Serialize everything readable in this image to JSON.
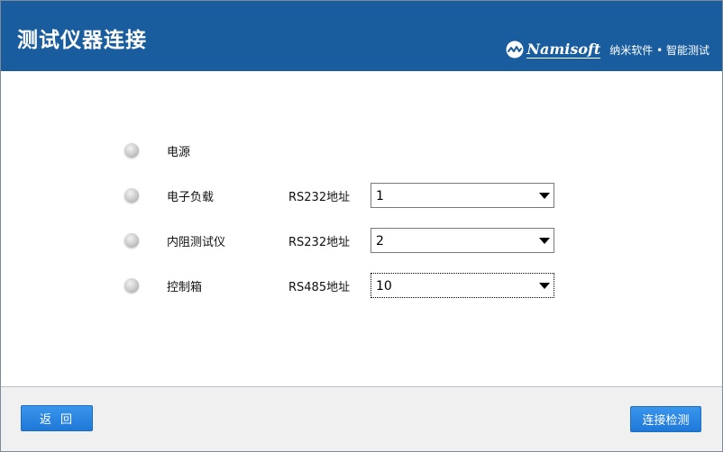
{
  "header": {
    "title": "测试仪器连接",
    "brand_name": "Namisoft",
    "brand_tagline": "纳米软件 • 智能测试",
    "logo_icon": "namisoft-logo-icon"
  },
  "devices": [
    {
      "name": "电源",
      "status_icon": "status-led-icon",
      "addr_label": "",
      "addr_value": ""
    },
    {
      "name": "电子负载",
      "status_icon": "status-led-icon",
      "addr_label": "RS232地址",
      "addr_value": "1"
    },
    {
      "name": "内阻测试仪",
      "status_icon": "status-led-icon",
      "addr_label": "RS232地址",
      "addr_value": "2"
    },
    {
      "name": "控制箱",
      "status_icon": "status-led-icon",
      "addr_label": "RS485地址",
      "addr_value": "10"
    }
  ],
  "footer": {
    "back_label": "返回",
    "connect_check_label": "连接检测"
  },
  "colors": {
    "header_bg": "#1a5d9e",
    "button_bg": "#1e78d8",
    "footer_bg": "#f0f0f0"
  }
}
